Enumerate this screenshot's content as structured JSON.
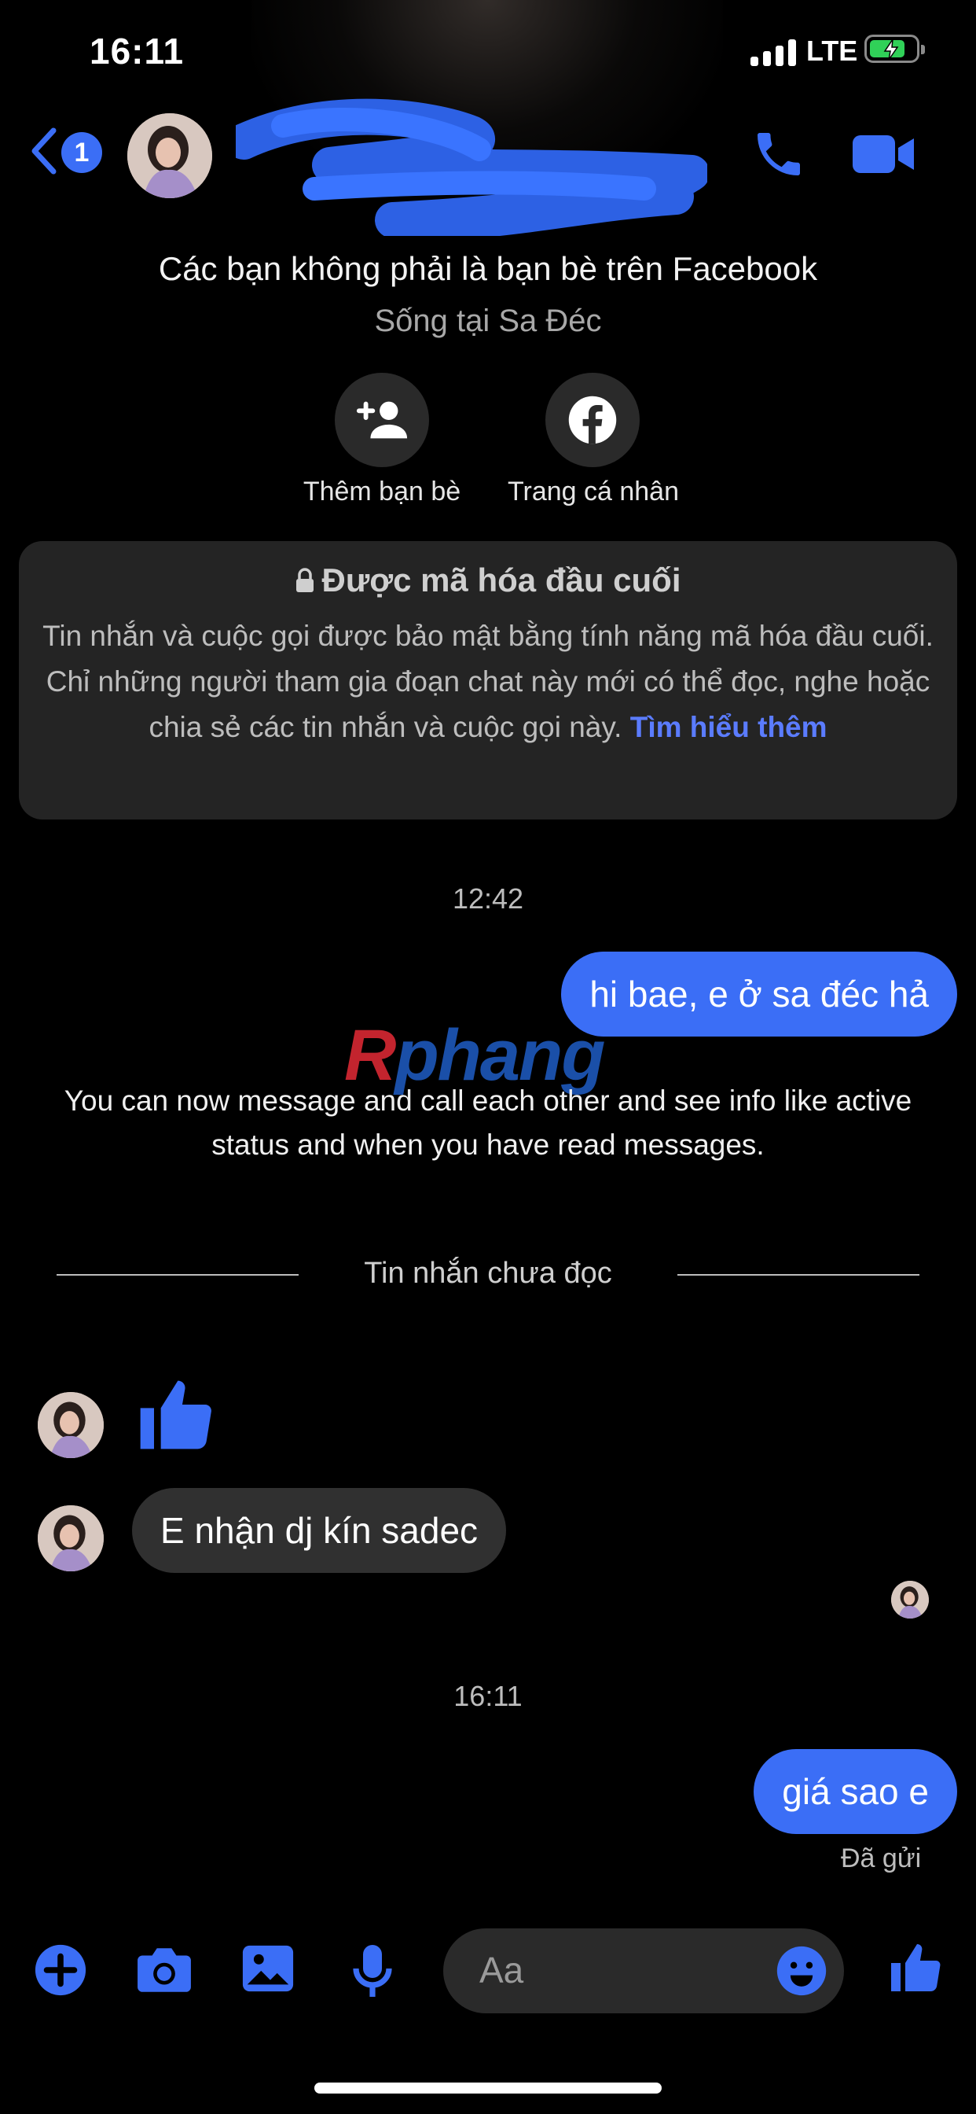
{
  "status_bar": {
    "time": "16:11",
    "network": "LTE"
  },
  "header": {
    "unread_count": "1"
  },
  "intro": {
    "not_friends": "Các bạn không phải là bạn bè trên Facebook",
    "location": "Sống tại Sa Đéc",
    "add_friend_label": "Thêm bạn bè",
    "profile_label": "Trang cá nhân"
  },
  "encryption_card": {
    "title": "Được mã hóa đầu cuối",
    "body": "Tin nhắn và cuộc gọi được bảo mật bằng tính năng mã hóa đầu cuối. Chỉ những người tham gia đoạn chat này mới có thể đọc, nghe hoặc chia sẻ các tin nhắn và cuộc gọi này.",
    "link": "Tìm hiểu thêm"
  },
  "conversation": {
    "timestamp_1": "12:42",
    "msg_out_1": "hi bae, e ở sa đéc hả",
    "system_notice": "You can now message and call each other and see info like active status and when you have read messages.",
    "unread_divider": "Tin nhắn chưa đọc",
    "msg_in_1": "E nhận dj kín sadec",
    "timestamp_2": "16:11",
    "msg_out_2": "giá sao e",
    "delivery_status": "Đã gửi"
  },
  "watermark": {
    "r": "R",
    "rest": "phang"
  },
  "composer": {
    "placeholder": "Aa"
  },
  "colors": {
    "accent": "#3b6ef6",
    "incoming_bubble": "#303030",
    "background": "#000000"
  }
}
